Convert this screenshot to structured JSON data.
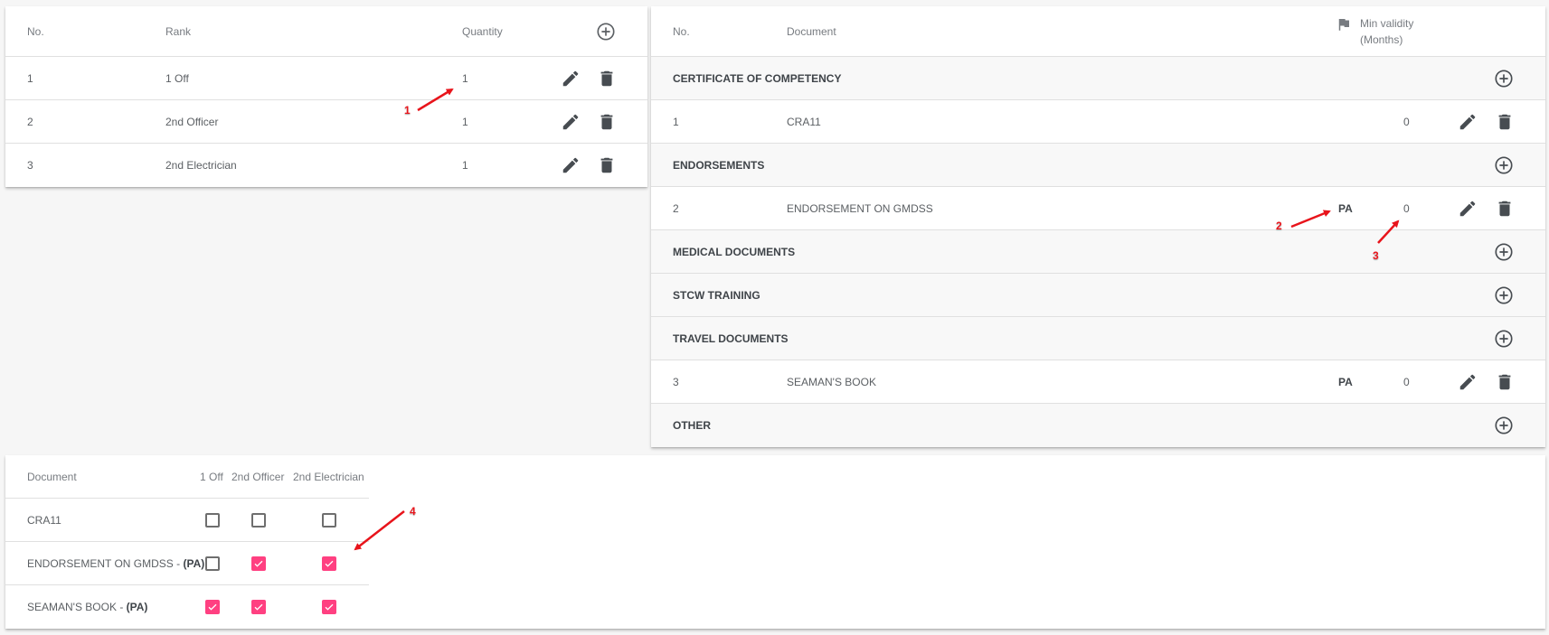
{
  "ranks_table": {
    "headers": {
      "no": "No.",
      "rank": "Rank",
      "quantity": "Quantity"
    },
    "rows": [
      {
        "no": "1",
        "rank": "1 Off",
        "quantity": "1"
      },
      {
        "no": "2",
        "rank": "2nd Officer",
        "quantity": "1"
      },
      {
        "no": "3",
        "rank": "2nd Electrician",
        "quantity": "1"
      }
    ]
  },
  "documents_table": {
    "headers": {
      "no": "No.",
      "document": "Document",
      "min_validity_line1": "Min validity",
      "min_validity_line2": "(Months)"
    },
    "groups": [
      {
        "title": "CERTIFICATE OF COMPETENCY",
        "rows": [
          {
            "no": "1",
            "document": "CRA11",
            "flag": "",
            "min_validity": "0"
          }
        ]
      },
      {
        "title": "ENDORSEMENTS",
        "rows": [
          {
            "no": "2",
            "document": "ENDORSEMENT ON GMDSS",
            "flag": "PA",
            "min_validity": "0"
          }
        ]
      },
      {
        "title": "MEDICAL DOCUMENTS",
        "rows": []
      },
      {
        "title": "STCW TRAINING",
        "rows": []
      },
      {
        "title": "TRAVEL DOCUMENTS",
        "rows": [
          {
            "no": "3",
            "document": "SEAMAN'S BOOK",
            "flag": "PA",
            "min_validity": "0"
          }
        ]
      },
      {
        "title": "OTHER",
        "rows": []
      }
    ]
  },
  "matrix_table": {
    "headers": {
      "document": "Document",
      "col1": "1 Off",
      "col2": "2nd Officer",
      "col3": "2nd Electrician"
    },
    "rows": [
      {
        "document": "CRA11",
        "suffix": "",
        "checks": [
          false,
          false,
          false
        ]
      },
      {
        "document": "ENDORSEMENT ON GMDSS",
        "suffix_sep": " - ",
        "suffix": "(PA)",
        "checks": [
          false,
          true,
          true
        ]
      },
      {
        "document": "SEAMAN'S BOOK",
        "suffix_sep": " - ",
        "suffix": "(PA)",
        "checks": [
          true,
          true,
          true
        ]
      }
    ]
  },
  "annotations": [
    "1",
    "2",
    "3",
    "4"
  ],
  "colors": {
    "accent": "#ff4081",
    "icon": "#474c51",
    "annotation": "#e8141b",
    "group_background": "#f8f8f8"
  }
}
